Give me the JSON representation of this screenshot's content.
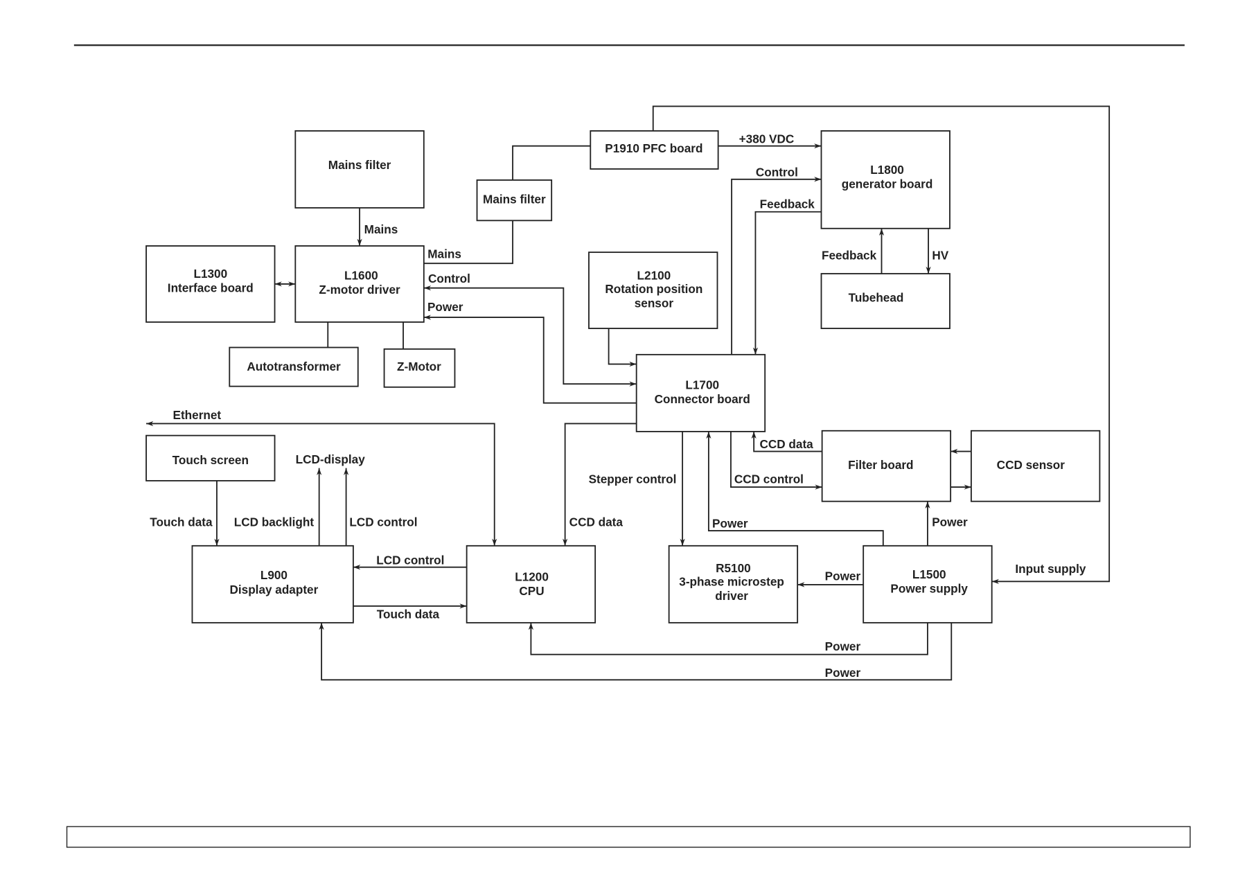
{
  "blocks": {
    "mains_filter_1": [
      "Mains filter"
    ],
    "mains_filter_2": [
      "Mains filter"
    ],
    "p1910": [
      "P1910 PFC board"
    ],
    "l1800": [
      "L1800",
      "generator board"
    ],
    "l1300": [
      "L1300",
      "Interface board"
    ],
    "l1600": [
      "L1600",
      "Z-motor driver"
    ],
    "l2100": [
      "L2100",
      "Rotation position",
      "sensor"
    ],
    "tubehead": [
      "Tubehead"
    ],
    "autotransformer": [
      "Autotransformer"
    ],
    "zmotor": [
      "Z-Motor"
    ],
    "l1700": [
      "L1700",
      "Connector board"
    ],
    "touch_screen": [
      "Touch screen"
    ],
    "filter_board": [
      "Filter board"
    ],
    "ccd_sensor": [
      "CCD sensor"
    ],
    "l900": [
      "L900",
      "Display adapter"
    ],
    "l1200": [
      "L1200",
      "CPU"
    ],
    "r5100": [
      "R5100",
      "3-phase microstep",
      "driver"
    ],
    "l1500": [
      "L1500",
      "Power supply"
    ]
  },
  "labels": {
    "mains_1": "Mains",
    "mains_2": "Mains",
    "vdc380": "+380 VDC",
    "control_gen": "Control",
    "feedback_gen": "Feedback",
    "feedback_tube": "Feedback",
    "hv": "HV",
    "control_zmotor": "Control",
    "power_zmotor": "Power",
    "ethernet": "Ethernet",
    "lcd_display": "LCD-display",
    "touch_data_1": "Touch data",
    "lcd_backlight": "LCD backlight",
    "lcd_control_1": "LCD control",
    "lcd_control_2": "LCD control",
    "touch_data_2": "Touch data",
    "ccd_data_cpu": "CCD data",
    "stepper_control": "Stepper control",
    "power_l1700": "Power",
    "ccd_data_filter": "CCD data",
    "ccd_control": "CCD control",
    "power_filter": "Power",
    "input_supply": "Input supply",
    "power_r5100": "Power",
    "power_cpu": "Power",
    "power_l900": "Power"
  }
}
